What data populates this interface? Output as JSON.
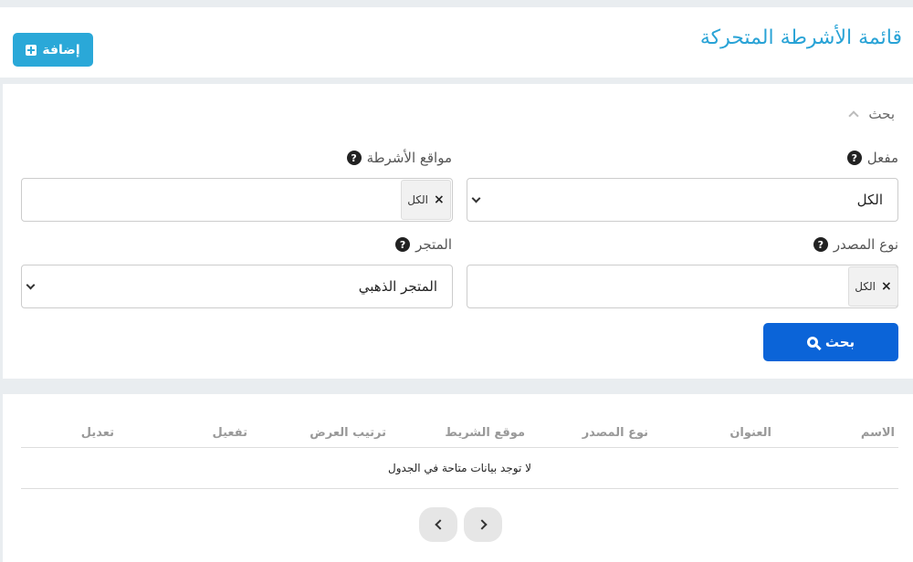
{
  "header": {
    "title": "قائمة الأشرطة المتحركة",
    "add_label": "إضافة"
  },
  "search": {
    "toggle_label": "بحث",
    "active": {
      "label": "مفعل",
      "value": "الكل"
    },
    "positions": {
      "label": "مواقع الأشرطة",
      "tag": "الكل"
    },
    "source_type": {
      "label": "نوع المصدر",
      "tag": "الكل"
    },
    "store": {
      "label": "المتجر",
      "value": "المتجر الذهبي"
    },
    "submit_label": "بحث"
  },
  "table": {
    "columns": [
      "الاسم",
      "العنوان",
      "نوع المصدر",
      "موقع الشريط",
      "ترتيب العرض",
      "تفعيل",
      "تعديل"
    ],
    "empty_text": "لا توجد بيانات متاحة في الجدول"
  },
  "icons": {
    "add": "plus-square-icon",
    "help": "question-circle-icon",
    "search": "magnifier-icon",
    "collapse": "chevron-up-icon",
    "prev": "chevron-left-icon",
    "next": "chevron-right-icon"
  },
  "colors": {
    "title": "#29a3d6",
    "add_button": "#2aa8d8",
    "search_button": "#0b64d8"
  }
}
